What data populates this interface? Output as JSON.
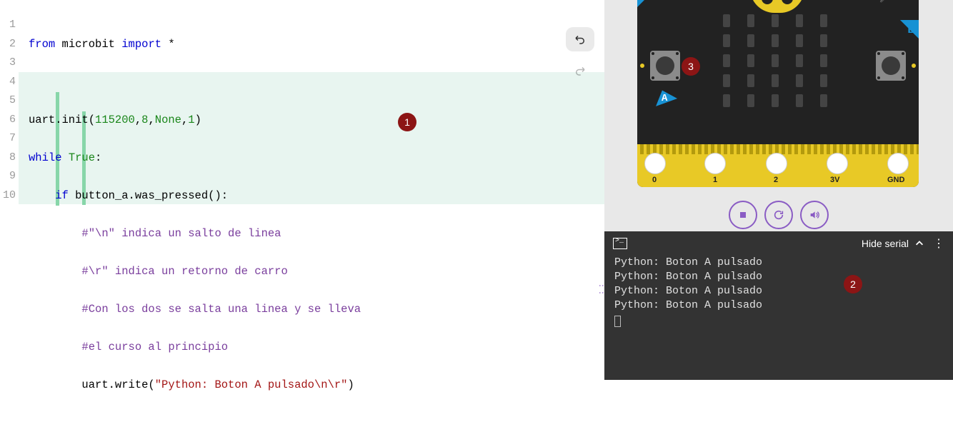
{
  "editor": {
    "lines": {
      "l1a": "from",
      "l1b": " microbit ",
      "l1c": "import",
      "l1d": " *",
      "l2": "",
      "l3a": "uart.init(",
      "l3b": "115200",
      "l3c": ",",
      "l3d": "8",
      "l3e": ",",
      "l3f": "None",
      "l3g": ",",
      "l3h": "1",
      "l3i": ")",
      "l4a": "while",
      "l4b": " ",
      "l4c": "True",
      "l4d": ":",
      "l5a": "    ",
      "l5b": "if",
      "l5c": " button_a.was_pressed():",
      "l6a": "        ",
      "l6b": "#\"\\n\" indica un salto de linea",
      "l7a": "        ",
      "l7b": "#\\r\" indica un retorno de carro",
      "l8a": "        ",
      "l8b": "#Con los dos se salta una linea y se lleva",
      "l9a": "        ",
      "l9b": "#el curso al principio",
      "l10a": "        uart.write(",
      "l10b": "\"Python: Boton A pulsado\\n\\r\"",
      "l10c": ")"
    },
    "linenums": {
      "n1": "1",
      "n2": "2",
      "n3": "3",
      "n4": "4",
      "n5": "5",
      "n6": "6",
      "n7": "7",
      "n8": "8",
      "n9": "9",
      "n10": "10"
    }
  },
  "board": {
    "pinlabels": {
      "p0": "0",
      "p1": "1",
      "p2": "2",
      "p3": "3V",
      "p4": "GND"
    },
    "buttonA": "A",
    "buttonB": "B"
  },
  "serial": {
    "hide_label": "Hide serial",
    "lines": {
      "s1": "Python: Boton A pulsado",
      "s2": "Python: Boton A pulsado",
      "s3": "Python: Boton A pulsado",
      "s4": "Python: Boton A pulsado"
    }
  },
  "annot": {
    "a1": "1",
    "a2": "2",
    "a3": "3"
  }
}
